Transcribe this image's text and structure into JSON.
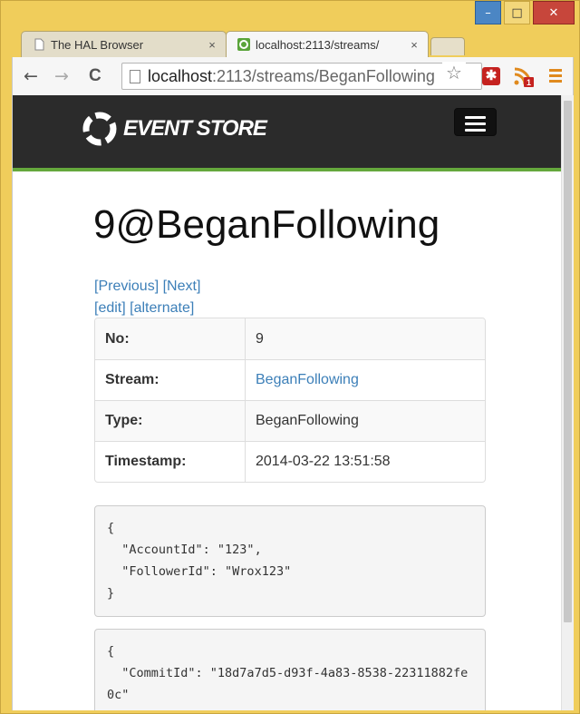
{
  "browser": {
    "tabs": [
      {
        "title": "The HAL Browser",
        "close": "×"
      },
      {
        "title": "localhost:2113/streams/",
        "close": "×"
      }
    ],
    "window_buttons": {
      "minimize": "–",
      "maximize": "□",
      "close": "✕"
    },
    "nav": {
      "back": "←",
      "forward": "→",
      "reload": "C"
    },
    "url_host": "localhost",
    "url_path": ":2113/streams/BeganFollowing",
    "bookmark": "☆",
    "extension_badge": "1",
    "extension_icon": "✱"
  },
  "site": {
    "logo_text": "EVENT STORE"
  },
  "event": {
    "title": "9@BeganFollowing",
    "links_row1": [
      "[Previous]",
      "[Next]"
    ],
    "links_row2": [
      "[edit]",
      "[alternate]"
    ],
    "rows": [
      {
        "label": "No:",
        "value": "9"
      },
      {
        "label": "Stream:",
        "value": "BeganFollowing"
      },
      {
        "label": "Type:",
        "value": "BeganFollowing"
      },
      {
        "label": "Timestamp:",
        "value": "2014-03-22 13:51:58"
      }
    ],
    "data_json": "{\n  \"AccountId\": \"123\",\n  \"FollowerId\": \"Wrox123\"\n}",
    "metadata_json": "{\n  \"CommitId\": \"18d7a7d5-d93f-4a83-8538-22311882fe0c\""
  },
  "colors": {
    "accent_green": "#65a83c",
    "link_blue": "#3c7fb8",
    "header_dark": "#2b2b2b"
  }
}
